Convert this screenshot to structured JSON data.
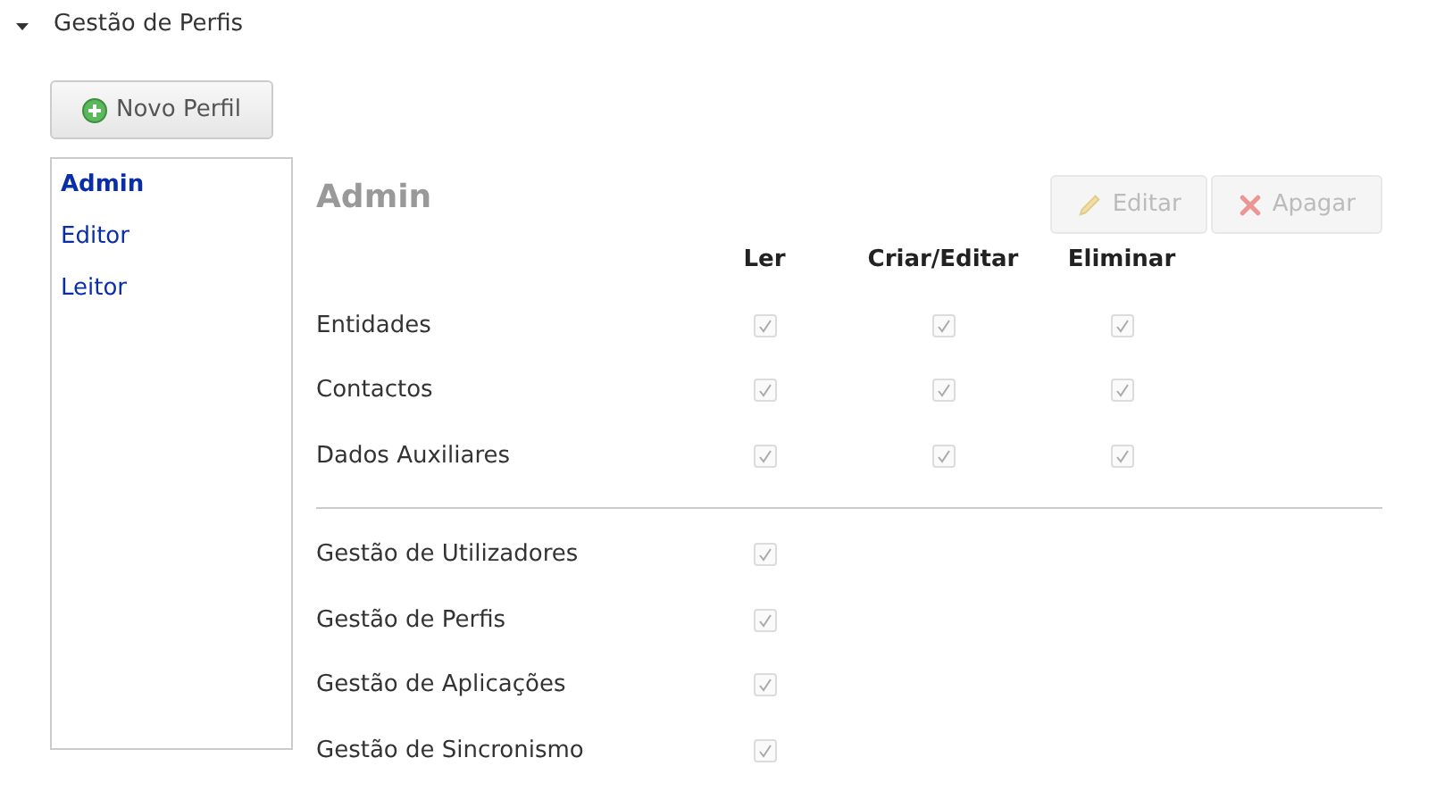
{
  "section": {
    "title": "Gestão de Perfis",
    "expanded": true
  },
  "new_button": {
    "label": "Novo Perfil"
  },
  "profiles": [
    {
      "label": "Admin",
      "selected": true
    },
    {
      "label": "Editor",
      "selected": false
    },
    {
      "label": "Leitor",
      "selected": false
    }
  ],
  "detail": {
    "title": "Admin",
    "actions": [
      {
        "kind": "edit",
        "label": "Editar",
        "disabled": true
      },
      {
        "kind": "delete",
        "label": "Apagar",
        "disabled": true
      }
    ],
    "columns": [
      "Ler",
      "Criar/Editar",
      "Eliminar"
    ],
    "groups": [
      [
        {
          "label": "Entidades",
          "cells": [
            {
              "checked": true,
              "disabled": true
            },
            {
              "checked": true,
              "disabled": true
            },
            {
              "checked": true,
              "disabled": true
            }
          ]
        },
        {
          "label": "Contactos",
          "cells": [
            {
              "checked": true,
              "disabled": true
            },
            {
              "checked": true,
              "disabled": true
            },
            {
              "checked": true,
              "disabled": true
            }
          ]
        },
        {
          "label": "Dados Auxiliares",
          "cells": [
            {
              "checked": true,
              "disabled": true
            },
            {
              "checked": true,
              "disabled": true
            },
            {
              "checked": true,
              "disabled": true
            }
          ]
        }
      ],
      [
        {
          "label": "Gestão de Utilizadores",
          "cells": [
            {
              "checked": true,
              "disabled": true
            }
          ]
        },
        {
          "label": "Gestão de Perfis",
          "cells": [
            {
              "checked": true,
              "disabled": true
            }
          ]
        },
        {
          "label": "Gestão de Aplicações",
          "cells": [
            {
              "checked": true,
              "disabled": true
            }
          ]
        },
        {
          "label": "Gestão de Sincronismo",
          "cells": [
            {
              "checked": true,
              "disabled": true
            }
          ]
        }
      ]
    ]
  }
}
